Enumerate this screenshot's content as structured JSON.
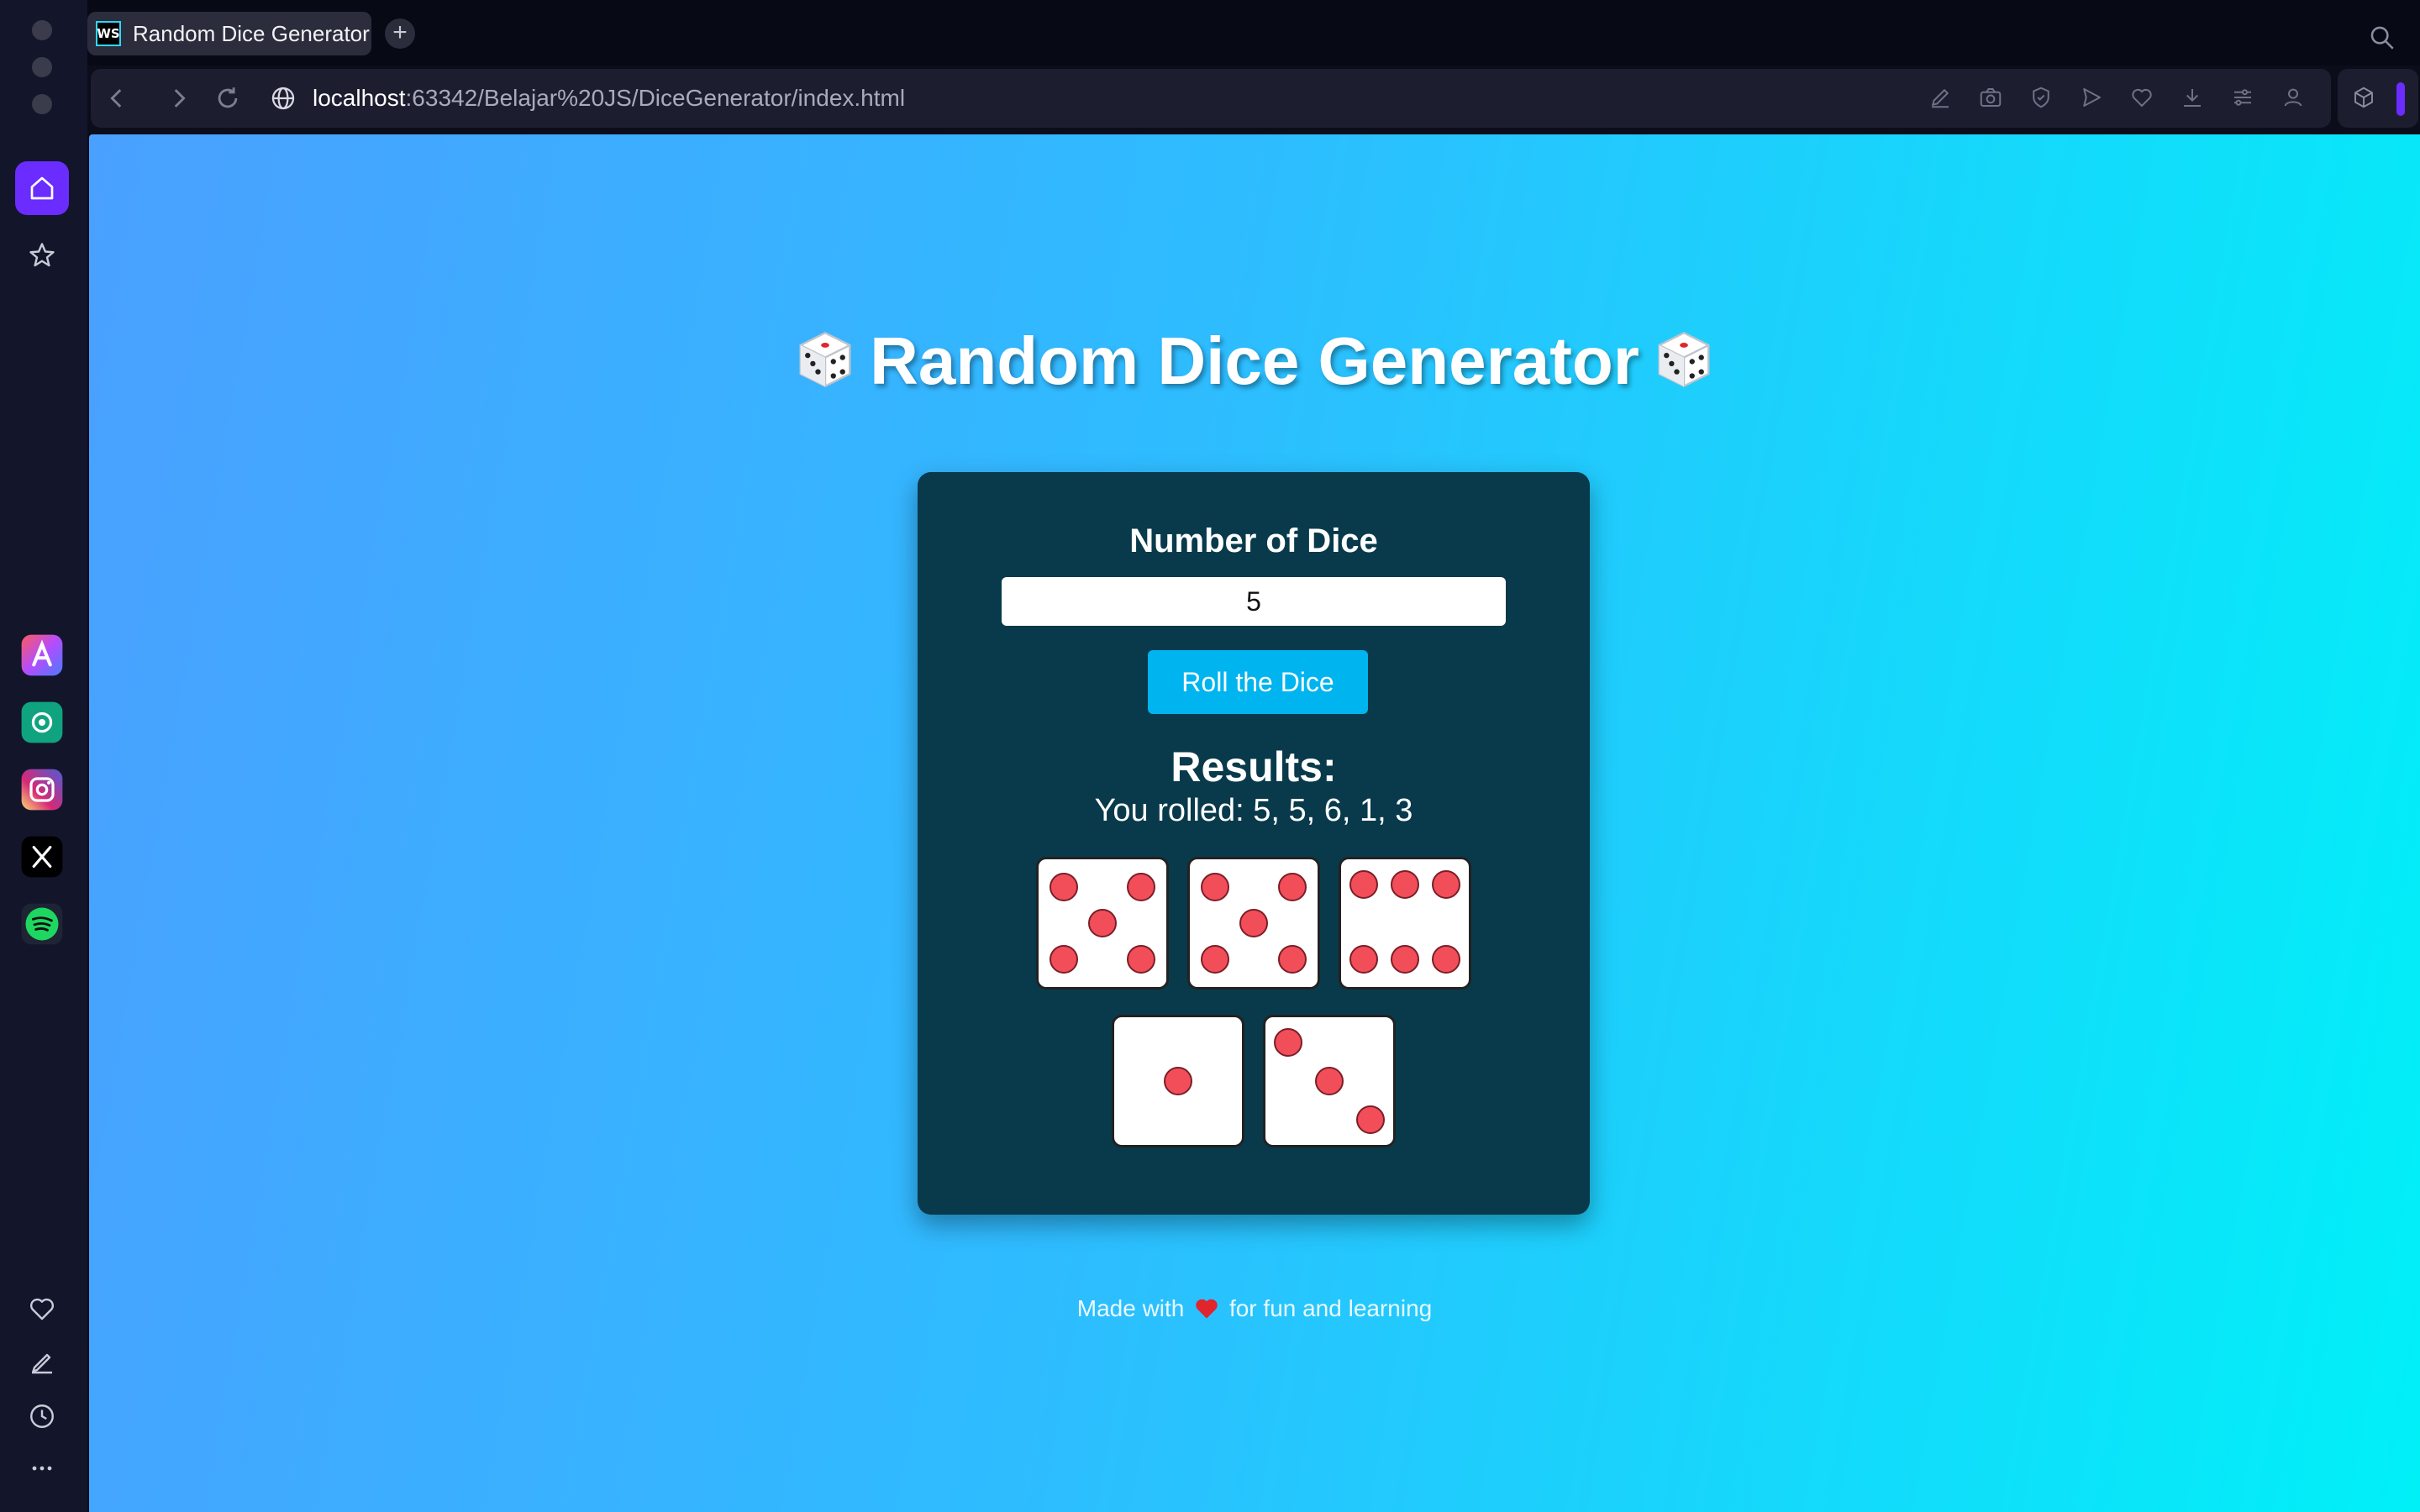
{
  "browser": {
    "tab_title": "Random Dice Generator",
    "tab_favicon_text": "WS",
    "new_tab_symbol": "+",
    "url_host": "localhost",
    "url_path": ":63342/Belajar%20JS/DiceGenerator/index.html",
    "toolbar_icons": [
      "edit-icon",
      "camera-icon",
      "shield-icon",
      "send-icon",
      "heart-icon",
      "download-icon",
      "settings-icon",
      "profile-icon"
    ],
    "sidebar_apps": [
      "aria-app",
      "chatgpt-app",
      "instagram-app",
      "x-app",
      "spotify-app"
    ],
    "accent_color": "#6a2cff"
  },
  "page": {
    "title": "Random Dice Generator",
    "input_label": "Number of Dice",
    "input_value": "5",
    "roll_button": "Roll the Dice",
    "results_heading": "Results:",
    "results_text": "You rolled: 5, 5, 6, 1, 3",
    "dice_values": [
      5,
      5,
      6,
      1,
      3
    ],
    "footer_before": "Made with",
    "footer_after": "for fun and learning",
    "card_color": "#083a4b",
    "pip_color": "#f24e5a",
    "button_color": "#00b4f0"
  }
}
